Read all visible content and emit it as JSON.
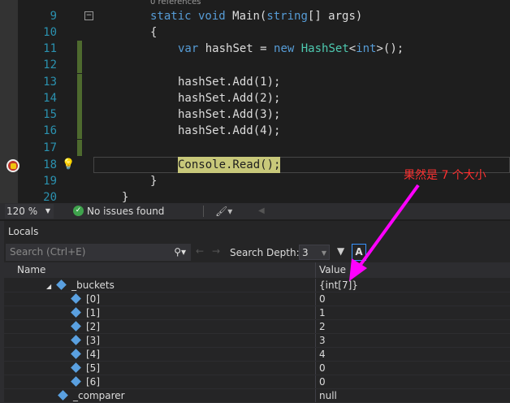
{
  "editor": {
    "codelens": "0 references",
    "lines": [
      {
        "n": "9"
      },
      {
        "n": "10"
      },
      {
        "n": "11"
      },
      {
        "n": "12"
      },
      {
        "n": "13"
      },
      {
        "n": "14"
      },
      {
        "n": "15"
      },
      {
        "n": "16"
      },
      {
        "n": "17"
      },
      {
        "n": "18"
      },
      {
        "n": "19"
      },
      {
        "n": "20"
      }
    ],
    "code": {
      "l9a": "static void ",
      "l9b": "Main(",
      "l9c": "string",
      "l9d": "[] args)",
      "l10": "{",
      "l11a": "var",
      " l11b": " hashSet = ",
      "l11c": "new",
      "l11d": "HashSet",
      "l11e": "<",
      "l11f": "int",
      "l11g": ">();",
      "l13": "hashSet.Add(1);",
      "l14": "hashSet.Add(2);",
      "l15": "hashSet.Add(3);",
      "l16": "hashSet.Add(4);",
      "l18": "Console.Read();",
      "l19": "}",
      "l20": "}"
    },
    "annotation": "果然是 7 个大小"
  },
  "status": {
    "zoom": "120 %",
    "issues": "No issues found"
  },
  "locals": {
    "title": "Locals",
    "search_placeholder": "Search (Ctrl+E)",
    "depth_label": "Search Depth:",
    "depth_value": "3",
    "columns": {
      "name": "Name",
      "value": "Value"
    },
    "rows": [
      {
        "name": "_buckets",
        "value": "{int[7]}"
      },
      {
        "name": "[0]",
        "value": "0"
      },
      {
        "name": "[1]",
        "value": "1"
      },
      {
        "name": "[2]",
        "value": "2"
      },
      {
        "name": "[3]",
        "value": "3"
      },
      {
        "name": "[4]",
        "value": "4"
      },
      {
        "name": "[5]",
        "value": "0"
      },
      {
        "name": "[6]",
        "value": "0"
      },
      {
        "name": "_comparer",
        "value": "null"
      }
    ]
  },
  "colors": {
    "accent": "#ff00ff",
    "annotation": "#ff3030"
  }
}
